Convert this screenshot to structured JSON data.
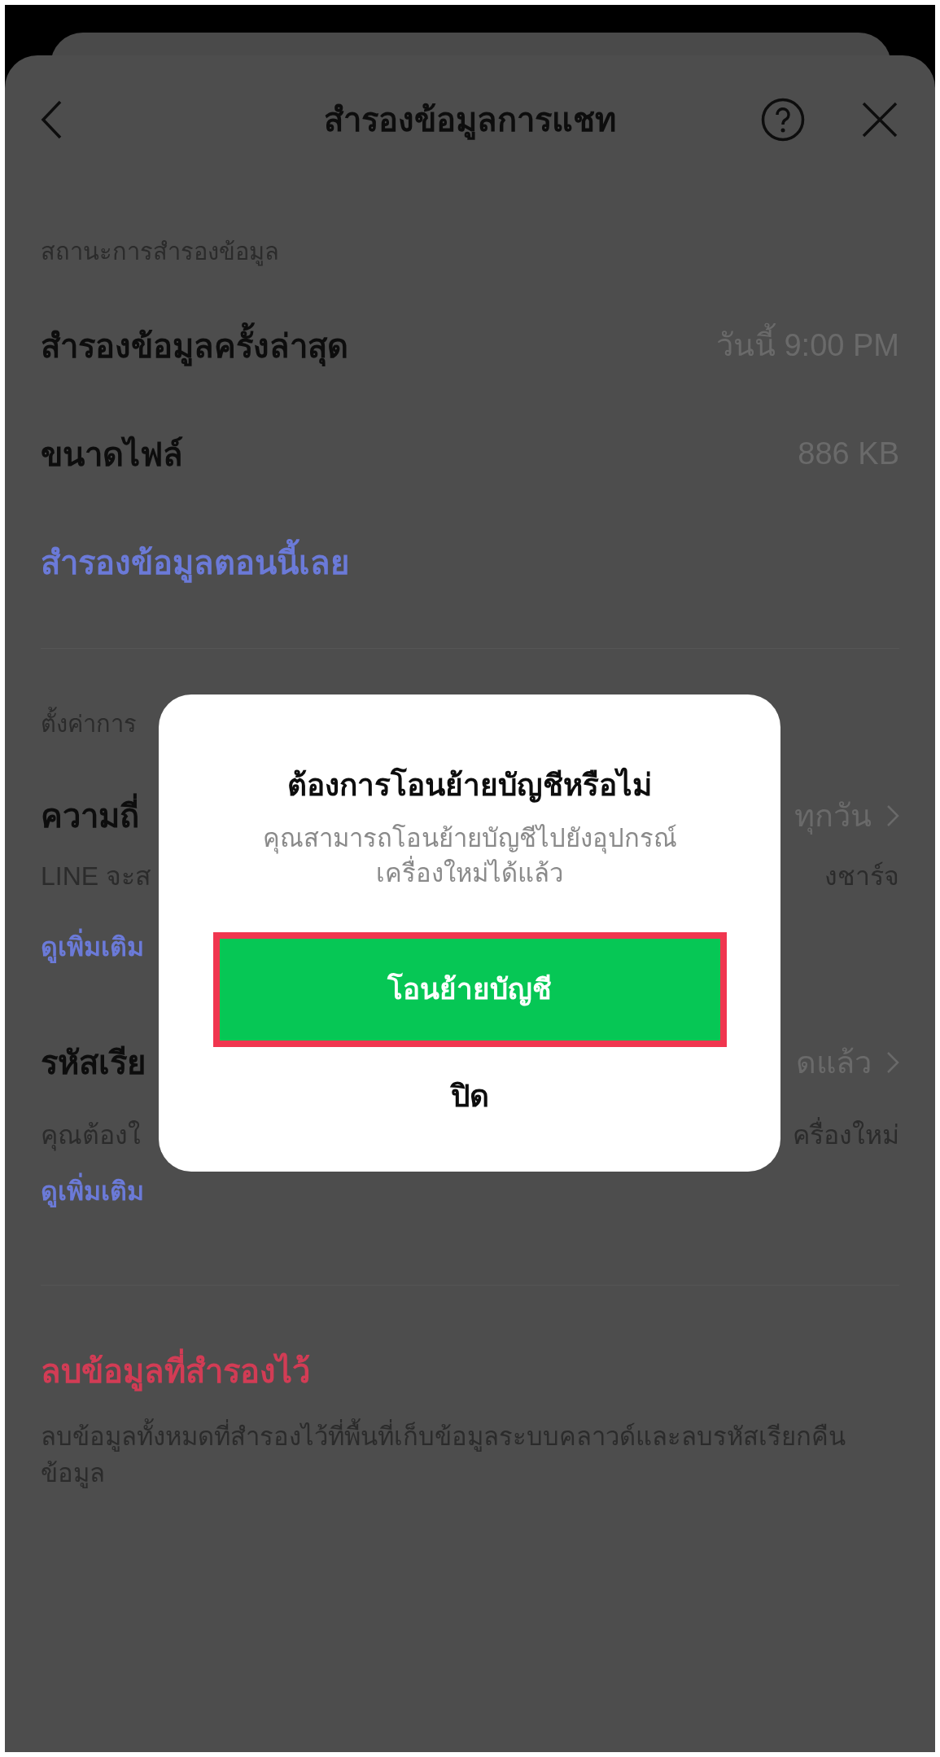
{
  "header": {
    "title": "สำรองข้อมูลการแชท"
  },
  "backup_status": {
    "label": "สถานะการสำรองข้อมูล",
    "rows": [
      {
        "label": "สำรองข้อมูลครั้งล่าสุด",
        "value": "วันนี้ 9:00 PM"
      },
      {
        "label": "ขนาดไฟล์",
        "value": "886 KB"
      }
    ],
    "action": "สำรองข้อมูลตอนนี้เลย"
  },
  "settings": {
    "label": "ตั้งค่าการ",
    "items": [
      {
        "label": "ความถี่",
        "value": "ทุกวัน",
        "description_start": "LINE จะส",
        "description_end": "งชาร์จ",
        "link": "ดูเพิ่มเติม"
      },
      {
        "label": "รหัสเรีย",
        "value": "ดแล้ว",
        "description_start": "คุณต้องใ",
        "description_end": "ครื่องใหม่",
        "link": "ดูเพิ่มเติม"
      }
    ]
  },
  "delete": {
    "title": "ลบข้อมูลที่สำรองไว้",
    "description": "ลบข้อมูลทั้งหมดที่สำรองไว้ที่พื้นที่เก็บข้อมูลระบบคลาวด์และลบรหัสเรียกคืนข้อมูล"
  },
  "dialog": {
    "title": "ต้องการโอนย้ายบัญชีหรือไม่",
    "message": "คุณสามารถโอนย้ายบัญชีไปยังอุปกรณ์เครื่องใหม่ได้แล้ว",
    "primary_button": "โอนย้ายบัญชี",
    "secondary_button": "ปิด",
    "primary_highlighted": true
  }
}
